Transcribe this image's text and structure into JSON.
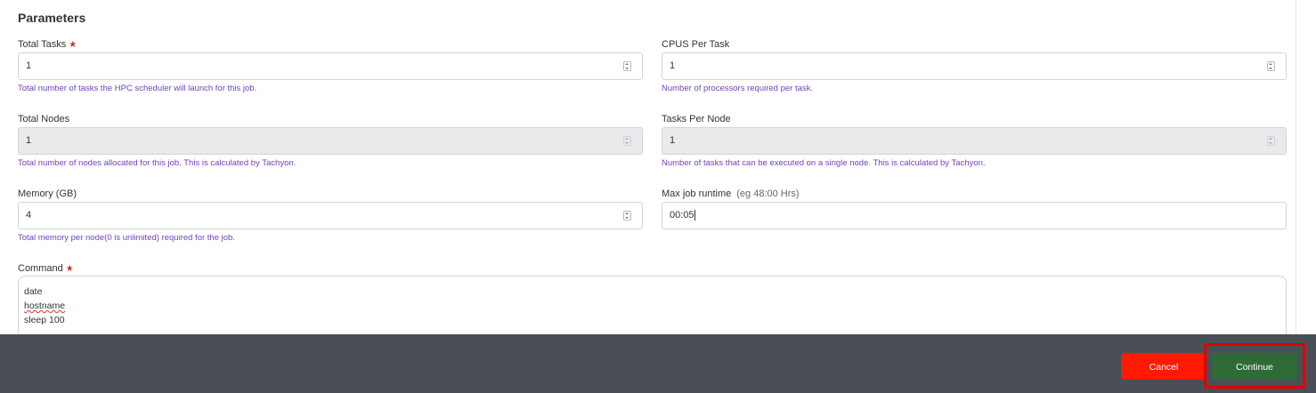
{
  "section": {
    "title": "Parameters"
  },
  "fields": {
    "total_tasks": {
      "label": "Total Tasks",
      "required_mark": "★",
      "value": "1",
      "help": "Total number of tasks the HPC scheduler will launch for this job."
    },
    "cpus_per_task": {
      "label": "CPUS Per Task",
      "value": "1",
      "help": "Number of processors required per task."
    },
    "total_nodes": {
      "label": "Total Nodes",
      "value": "1",
      "help": "Total number of nodes allocated for this job. This is calculated by Tachyon."
    },
    "tasks_per_node": {
      "label": "Tasks Per Node",
      "value": "1",
      "help": "Number of tasks that can be executed on a single node. This is calculated by Tachyon."
    },
    "memory": {
      "label": "Memory (GB)",
      "value": "4",
      "help": "Total memory per node(0 is unlimited) required for the job."
    },
    "max_runtime": {
      "label": "Max job runtime",
      "hint": "(eg 48:00 Hrs)",
      "value": "00:05"
    },
    "command": {
      "label": "Command",
      "required_mark": "★",
      "lines": [
        "date",
        "hostname",
        "sleep 100"
      ]
    }
  },
  "footer": {
    "cancel_label": "Cancel",
    "continue_label": "Continue"
  },
  "colors": {
    "help_text": "#6f42c1",
    "footer_bg": "#4a4f57",
    "cancel_bg": "#ff1a00",
    "continue_bg": "#2e6b37",
    "highlight": "#e00000"
  }
}
